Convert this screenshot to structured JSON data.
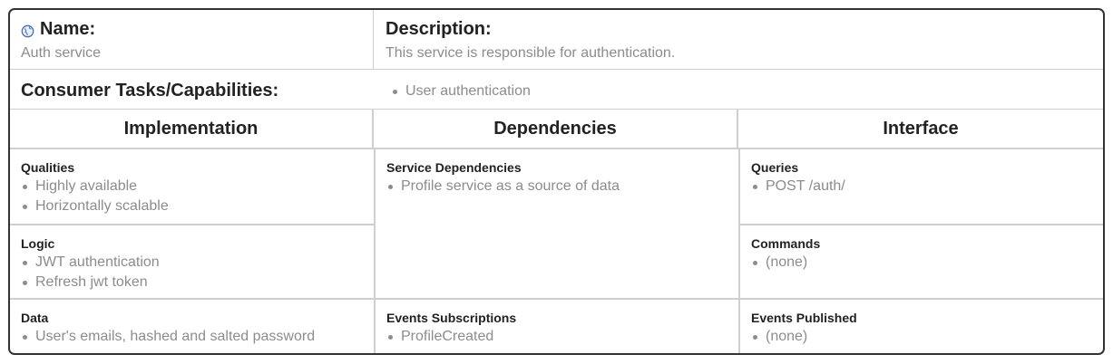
{
  "name_label": "Name:",
  "name_value": "Auth service",
  "description_label": "Description:",
  "description_value": "This service is responsible for authentication.",
  "consumer_tasks_label": "Consumer Tasks/Capabilities:",
  "consumer_tasks": [
    "User authentication"
  ],
  "columns": {
    "implementation": "Implementation",
    "dependencies": "Dependencies",
    "interface": "Interface"
  },
  "implementation": {
    "qualities": {
      "title": "Qualities",
      "items": [
        "Highly available",
        "Horizontally scalable"
      ]
    },
    "logic": {
      "title": "Logic",
      "items": [
        "JWT authentication",
        "Refresh jwt token"
      ]
    },
    "data": {
      "title": "Data",
      "items": [
        "User's emails, hashed and salted password"
      ]
    }
  },
  "dependencies": {
    "service_dependencies": {
      "title": "Service Dependencies",
      "items": [
        "Profile service as a source of data"
      ]
    },
    "events_subscriptions": {
      "title": "Events Subscriptions",
      "items": [
        "ProfileCreated"
      ]
    }
  },
  "interface": {
    "queries": {
      "title": "Queries",
      "items": [
        "POST /auth/"
      ]
    },
    "commands": {
      "title": "Commands",
      "items": [
        "(none)"
      ]
    },
    "events_published": {
      "title": "Events Published",
      "items": [
        "(none)"
      ]
    }
  },
  "icons": {
    "name_icon": "globe-icon"
  },
  "colors": {
    "border": "#333333",
    "divider": "#cfcfcf",
    "muted_text": "#8c8c8c",
    "heading_text": "#222222"
  }
}
